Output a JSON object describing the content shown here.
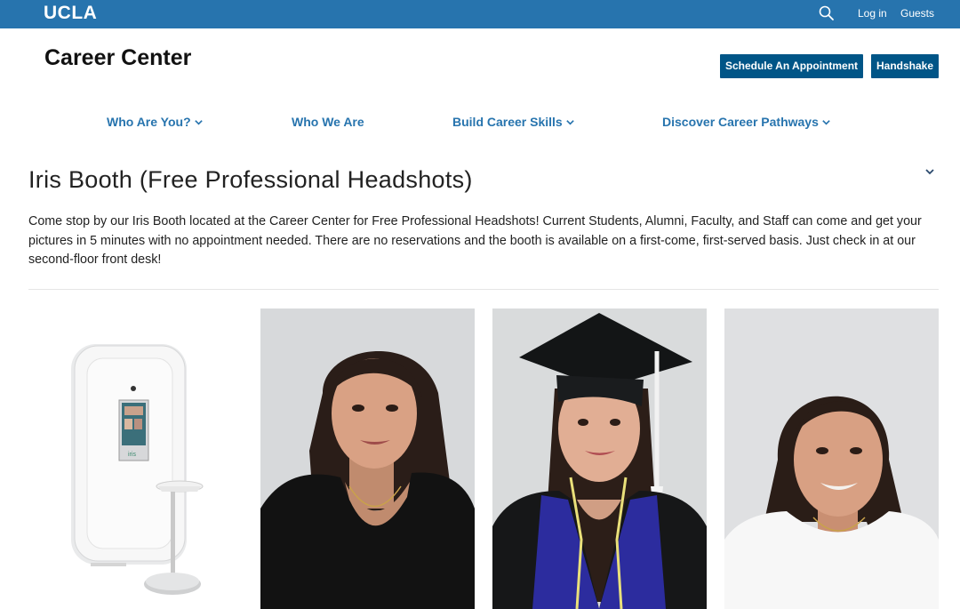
{
  "topbar": {
    "logo": "UCLA",
    "search_icon": "search-icon",
    "login_label": "Log in",
    "guests_label": "Guests"
  },
  "header": {
    "site_title": "Career Center",
    "appointment_button": "Schedule An Appointment",
    "handshake_button": "Handshake"
  },
  "nav": {
    "items": [
      {
        "label": "Who Are You?",
        "has_dropdown": true
      },
      {
        "label": "Who We Are",
        "has_dropdown": false
      },
      {
        "label": "Build Career Skills",
        "has_dropdown": true
      },
      {
        "label": "Discover Career Pathways",
        "has_dropdown": true
      }
    ]
  },
  "main": {
    "title": "Iris Booth (Free Professional Headshots)",
    "intro": "Come stop by our Iris Booth located at the Career Center for Free Professional Headshots! Current Students, Alumni, Faculty, and Staff can come and get your pictures in 5 minutes with no appointment needed. There are no reservations and the booth is available on a first-come, first-served basis. Just check in at our second-floor front desk!",
    "collapse_icon": "chevron-down-icon"
  },
  "gallery": {
    "booth_screen_text": "iris",
    "images": [
      "iris-booth-photo",
      "headshot-photo",
      "graduation-headshot-photo",
      "headshot-photo"
    ]
  },
  "colors": {
    "topbar": "#2774ae",
    "button": "#005587",
    "nav_link": "#2774ae"
  }
}
